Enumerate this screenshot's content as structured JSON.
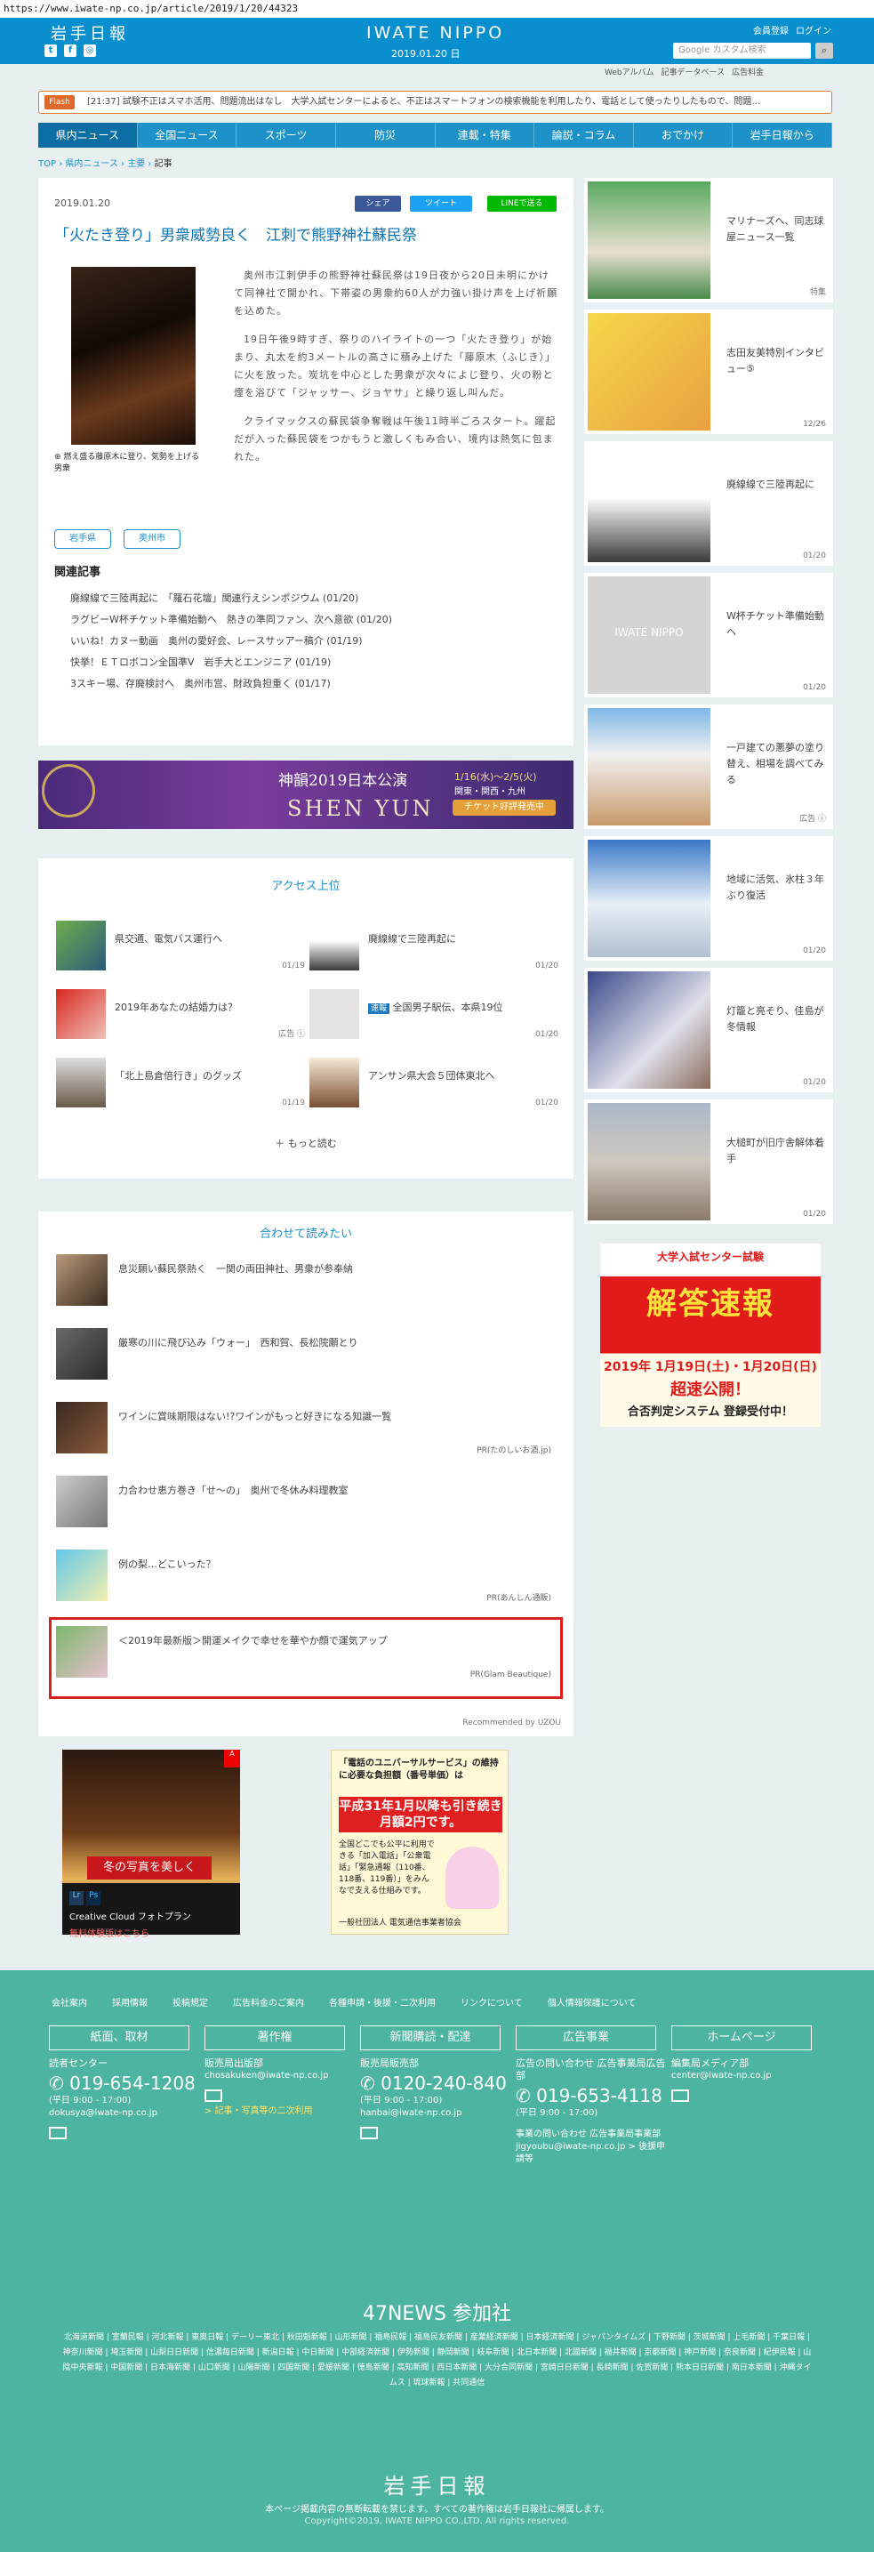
{
  "browser": {
    "url": "https://www.iwate-np.co.jp/article/2019/1/20/44323"
  },
  "header": {
    "logo": "岩手日報",
    "center_logo": "IWATE NIPPO",
    "date": "2019.01.20 日",
    "member_register": "会員登録",
    "login": "ログイン",
    "search_placeholder": "Google カスタム検索"
  },
  "subnav": [
    "Webアルバム",
    "記事データベース",
    "広告料金"
  ],
  "flash": {
    "tag": "Flash",
    "text": "[21:37] 試験不正はスマホ活用、問題流出はなし　大学入試センターによると、不正はスマートフォンの検索機能を利用したり、電話として使ったりしたもので、問題…"
  },
  "nav": [
    "県内ニュース",
    "全国ニュース",
    "スポーツ",
    "防災",
    "連載・特集",
    "論説・コラム",
    "おでかけ",
    "岩手日報から"
  ],
  "breadcrumb": [
    "TOP",
    "県内ニュース",
    "主要",
    "記事"
  ],
  "article": {
    "date": "2019.01.20",
    "share": "シェア",
    "tweet": "ツイート",
    "line": "LINEで送る",
    "title": "「火たき登り」男衆威勢良く　江刺で熊野神社蘇民祭",
    "caption": "燃え盛る藤原木に登り、気勢を上げる男衆",
    "paragraphs": [
      "奥州市江刺伊手の熊野神社蘇民祭は19日夜から20日未明にかけて同神社で開かれ、下帯姿の男衆約60人が力強い掛け声を上げ祈願を込めた。",
      "19日午後9時すぎ、祭りのハイライトの一つ「火たき登り」が始まり、丸太を約3メートルの高さに積み上げた「藤原木（ふじき）」に火を放った。炭坑を中心とした男衆が次々によじ登り、火の粉と煙を浴びて「ジャッサー、ジョヤサ」と繰り返し叫んだ。",
      "クライマックスの蘇民袋争奪戦は午後11時半ごろスタート。躍起だが入った蘇民袋をつかもうと激しくもみ合い、境内は熱気に包まれた。"
    ],
    "tags": [
      "岩手県",
      "奥州市"
    ],
    "related_heading": "関連記事",
    "related": [
      "廃線線で三陸再起に　「羅石花壇」関連行えシンポジウム (01/20)",
      "ラグビーW杯チケット準備始動へ　熱きの準同ファン、次へ意欲 (01/20)",
      "いいね！カヌー動画　奥州の愛好会、レースサッアー稿介 (01/19)",
      "快挙！ＥＴロボコン全国準Ⅴ　岩手大とエンジニア (01/19)",
      "3スキー場、存廃検討へ　奥州市営、財政負担重く (01/17)"
    ]
  },
  "ads": {
    "shenyun": {
      "title": "神韻2019日本公演",
      "subtitle": "SHEN YUN",
      "dates": "1/16(水)～2/5(火)",
      "regions": "関東・関西・九州",
      "cta": "チケット好評発売中"
    },
    "adobe": {
      "headline": "冬の写真を美しく",
      "product": "Creative Cloud フォトプラン",
      "cta": "無料体験版はこちら"
    },
    "usf": {
      "head": "「電話のユニバーサルサービス」の維持に必要な負担額（番号単価）は",
      "highlight": "平成31年1月以降も引き続き月額2円です。",
      "body": "全国どこでも公平に利用できる「加入電話」「公衆電話」「緊急通報（110番、118番、119番）」をみんなで支える仕組みです。",
      "footer": "一般社団法人 電気通信事業者協会"
    },
    "exam": {
      "badge": "大学入試センター試験",
      "headline": "解答速報",
      "dates": "2019年 1月19日(土)・1月20日(日)",
      "open": "超速公開！",
      "system": "合否判定システム 登録受付中！"
    }
  },
  "access": {
    "heading": "アクセス上位",
    "items": [
      {
        "title": "県交通、電気バス運行へ",
        "date": "01/19"
      },
      {
        "title": "廃線線で三陸再起に",
        "date": "01/20"
      },
      {
        "title": "2019年あなたの結婚力は？",
        "date": "",
        "ad": "広告"
      },
      {
        "badge": "速報",
        "title": "全国男子駅伝、本県19位",
        "date": "01/20"
      },
      {
        "title": "「北上島倉倍行き」のグッズ",
        "date": "01/19"
      },
      {
        "title": "アンサン県大会５団体東北へ",
        "date": "01/20"
      }
    ],
    "more": "もっと読む"
  },
  "recommend": {
    "heading": "合わせて読みたい",
    "items": [
      {
        "title": "息災願い蘇民祭熱く　一関の両田神社、男衆が参奉納",
        "pr": ""
      },
      {
        "title": "厳寒の川に飛び込み「ウォー」　西和賀、長松院願とり",
        "pr": ""
      },
      {
        "title": "ワインに賞味期限はない!?ワインがもっと好きになる知識一覧",
        "pr": "PR(たのしいお酒.jp)"
      },
      {
        "title": "力合わせ恵方巻き「せ～の」　奥州で冬休み料理教室",
        "pr": ""
      },
      {
        "title": "例の梨…どこいった？",
        "pr": "PR(あんしん通販)"
      },
      {
        "title": "＜2019年最新版＞開運メイクで幸せを華やか顔で運気アップ",
        "pr": "PR(Glam Beautique)"
      }
    ],
    "recommended_by": "Recommended by UZOU"
  },
  "sidebar": [
    {
      "title": "マリナーズへ、同志球屋ニュース一覧",
      "date": "特集"
    },
    {
      "title": "志田友美特別インタビュー⑤",
      "date": "12/26"
    },
    {
      "title": "廃線線で三陸再起に",
      "date": "01/20"
    },
    {
      "title": "W杯チケット準備始動へ",
      "date": "01/20"
    },
    {
      "title": "一戸建ての悪夢の塗り替え、相場を調べてみる",
      "date": "広告"
    },
    {
      "title": "地域に活気、氷柱３年ぶり復活",
      "date": "01/20"
    },
    {
      "title": "灯籠と亮そり、佳島が冬情報",
      "date": "01/20"
    },
    {
      "title": "大槌町が旧庁舎解体着手",
      "date": "01/20"
    }
  ],
  "footer": {
    "links": [
      "会社案内",
      "採用情報",
      "投稿規定",
      "広告料金のご案内",
      "各種申請・後援・二次利用",
      "リンクについて",
      "個人情報保護について"
    ],
    "sections": [
      {
        "label": "紙面、取材",
        "name": "読者センター",
        "tel": "019-654-1208",
        "hours": "(平日 9:00 - 17:00)",
        "email": "dokusya@iwate-np.co.jp",
        "extra": ""
      },
      {
        "label": "著作権",
        "name": "販売局出版部",
        "tel": "",
        "hours": "",
        "email": "chosakuken@iwate-np.co.jp",
        "extra": "> 記事・写真等の二次利用"
      },
      {
        "label": "新聞購読・配達",
        "name": "販売局販売部",
        "tel": "0120-240-840",
        "hours": "(平日 9:00 - 17:00)",
        "email": "hanbai@iwate-np.co.jp",
        "extra": ""
      },
      {
        "label": "広告事業",
        "name": "広告の問い合わせ 広告事業局広告部",
        "tel": "019-653-4118",
        "hours": "(平日 9:00 - 17:00)",
        "email": "",
        "extra": "事業の問い合わせ 広告事業局事業部 jigyoubu@iwate-np.co.jp > 後援申請等"
      },
      {
        "label": "ホームページ",
        "name": "編集局メディア部",
        "tel": "",
        "hours": "",
        "email": "center@iwate-np.co.jp",
        "extra": ""
      }
    ],
    "news47": "47NEWS 参加社",
    "papers": "北海道新聞 | 室蘭民報 | 河北新報 | 東奥日報 | デーリー東北 | 秋田魁新報 | 山形新聞 | 福島民報 | 福島民友新聞 | 産業経済新聞 | 日本経済新聞 | ジャパンタイムズ | 下野新聞 | 茨城新聞 | 上毛新聞 | 千葉日報 | 神奈川新聞 | 埼玉新聞 | 山梨日日新聞 | 信濃毎日新聞 | 新潟日報 | 中日新聞 | 中部経済新聞 | 伊勢新聞 | 静岡新聞 | 岐阜新聞 | 北日本新聞 | 北國新聞 | 福井新聞 | 京都新聞 | 神戸新聞 | 奈良新聞 | 紀伊民報 | 山陰中央新報 | 中国新聞 | 日本海新聞 | 山口新聞 | 山陽新聞 | 四国新聞 | 愛媛新聞 | 徳島新聞 | 高知新聞 | 西日本新聞 | 大分合同新聞 | 宮崎日日新聞 | 長崎新聞 | 佐賀新聞 | 熊本日日新聞 | 南日本新聞 | 沖縄タイムス | 琉球新報 | 共同通信",
    "logo": "岩手日報",
    "notice": "本ページ掲載内容の無断転載を禁じます。すべての著作権は岩手日報社に帰属します。",
    "copyright": "Copyright©2019, IWATE NIPPO CO.,LTD. All rights reserved."
  }
}
